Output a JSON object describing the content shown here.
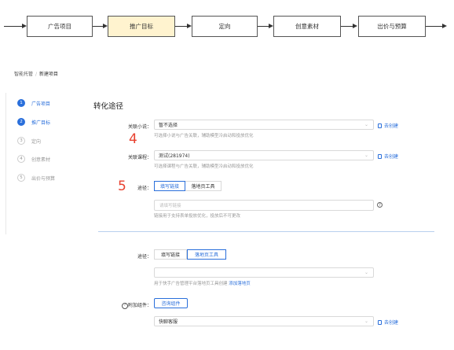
{
  "flow": {
    "steps": [
      "广告项目",
      "推广目标",
      "定向",
      "创意素材",
      "出价与预算"
    ],
    "active_index": 1
  },
  "breadcrumb": {
    "root": "智能托管",
    "separator": "/",
    "current": "新建项目"
  },
  "sidebar": {
    "steps": [
      {
        "num": "1",
        "label": "广告项目"
      },
      {
        "num": "2",
        "label": "推广目标"
      },
      {
        "num": "3",
        "label": "定向"
      },
      {
        "num": "4",
        "label": "创意素材"
      },
      {
        "num": "5",
        "label": "出价与预算"
      }
    ]
  },
  "section": {
    "title": "转化途径",
    "novel": {
      "label": "关联小说：",
      "value": "暂不选择",
      "hint": "可选择小说与广告关联，辅助模型冷启动和投放优化",
      "create": "去创建"
    },
    "annotation_4": "4",
    "course": {
      "label": "关联课程：",
      "value": "测试(281974)",
      "hint": "可选择课程与广告关联，辅助模型冷启动和投放优化",
      "create": "去创建"
    },
    "annotation_5": "5",
    "path1": {
      "label": "途径：",
      "options": [
        "填写链接",
        "落地页工具"
      ],
      "selected": 0,
      "url_placeholder": "请填写链接",
      "hint": "链接用于支持表单投放优化，投放后不可更改"
    },
    "path2": {
      "label": "途径：",
      "options": [
        "填写链接",
        "落地页工具"
      ],
      "selected": 1,
      "hint_prefix": "用于快手广告管理平台落地页工具创建",
      "hint_link": "添加落地页"
    },
    "component": {
      "label": "附加组件：",
      "button": "咨询组件",
      "select_value": "快聊客服",
      "create": "去创建"
    }
  }
}
